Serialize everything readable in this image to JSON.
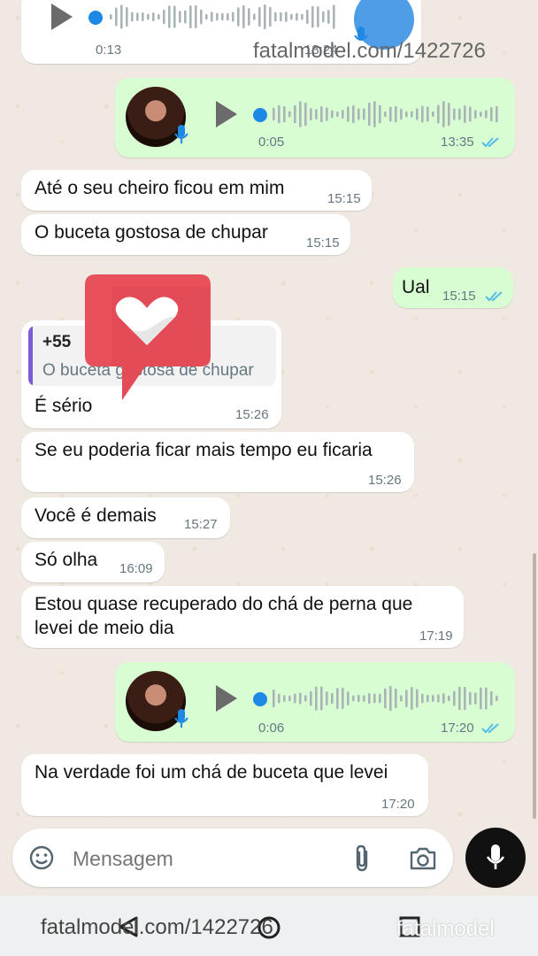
{
  "messages": [
    {
      "text": "",
      "time": "13:24",
      "duration": "0:13"
    },
    {
      "text": "",
      "time": "13:35",
      "duration": "0:05"
    },
    {
      "text": "Até o seu cheiro ficou em mim",
      "time": "15:15"
    },
    {
      "text": "O buceta gostosa de chupar",
      "time": "15:15"
    },
    {
      "text": "Ual",
      "time": "15:15"
    },
    {
      "text": "É sério",
      "time": "15:26",
      "reply_sender": "+55",
      "reply_text": "O buceta gostosa de chupar"
    },
    {
      "text": "Se eu poderia ficar mais tempo eu ficaria",
      "time": "15:26"
    },
    {
      "text": "Você é demais",
      "time": "15:27"
    },
    {
      "text": "Só olha",
      "time": "16:09"
    },
    {
      "line1": "Estou quase recuperado do chá de perna que",
      "line2": "levei de meio dia",
      "time": "17:19"
    },
    {
      "text": "",
      "time": "17:20",
      "duration": "0:06"
    },
    {
      "text": "Na verdade foi um chá de buceta que levei",
      "time": "17:20"
    }
  ],
  "input": {
    "placeholder": "Mensagem"
  },
  "watermarks": {
    "top": "fatalmodel.com/1422726",
    "bottom": "fatalmodel.com/1422726",
    "logo": "fatalmodel"
  },
  "colors": {
    "outgoing_bubble": "#d9fdd3",
    "incoming_bubble": "#ffffff",
    "read_ticks": "#53bdeb",
    "progress": "#1e88e5",
    "heart_badge": "#e8505b"
  },
  "icons": [
    "play-icon",
    "mic-icon",
    "emoji-icon",
    "attach-icon",
    "camera-icon",
    "read-ticks-icon",
    "heart-badge-icon"
  ]
}
